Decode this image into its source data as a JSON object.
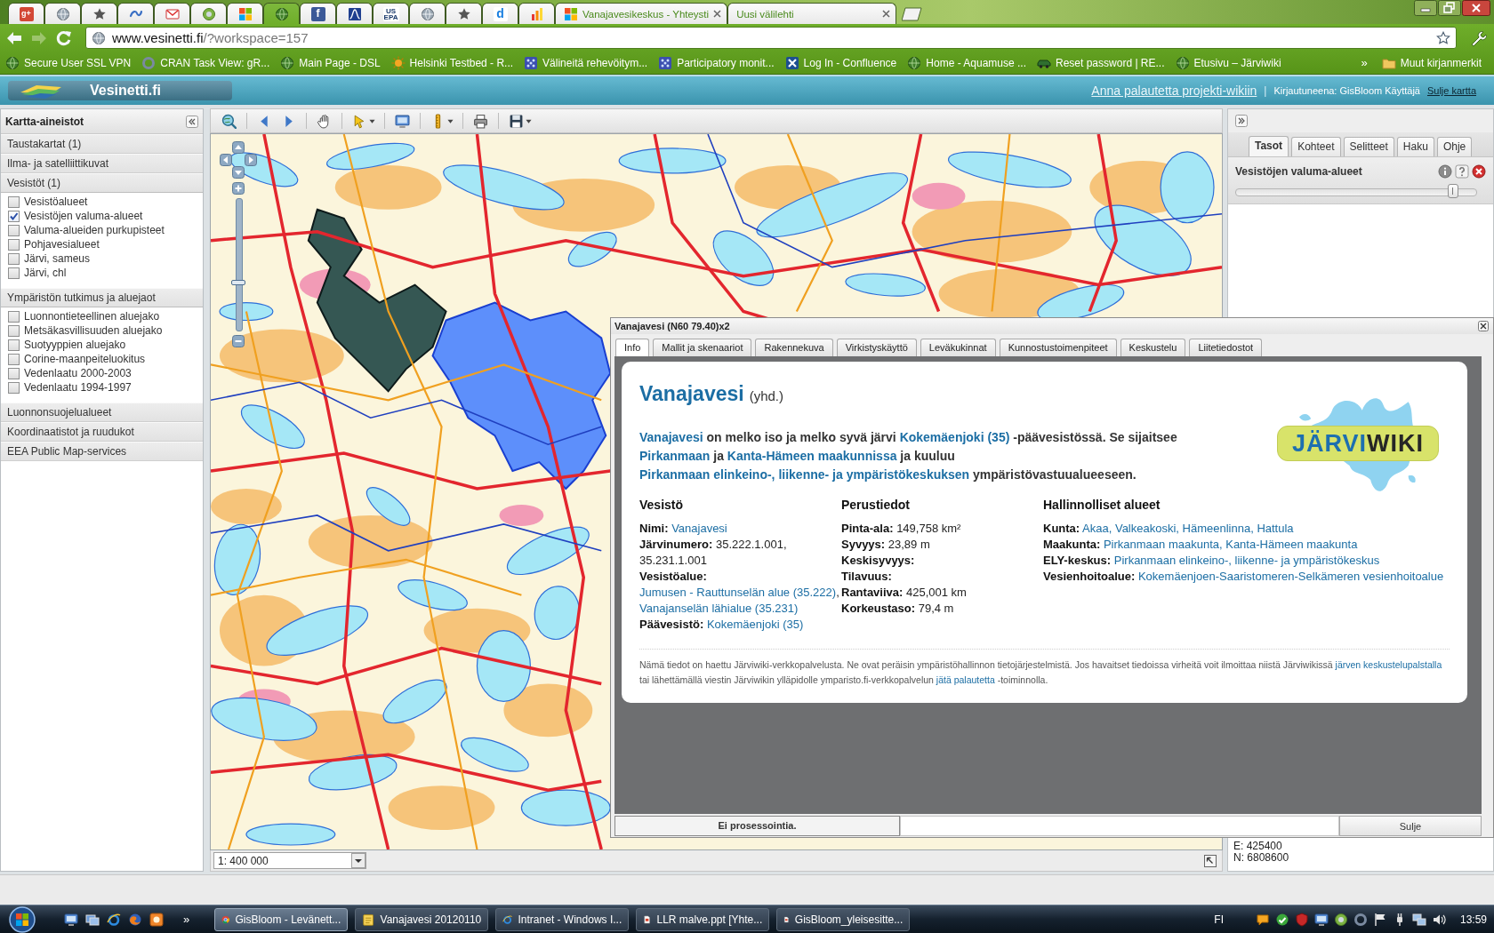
{
  "browser": {
    "pinned_tabs": [
      {
        "label": "g+",
        "selected": false
      },
      {
        "selected": false
      },
      {
        "selected": false
      },
      {
        "selected": false
      },
      {
        "selected": false
      },
      {
        "selected": false
      },
      {
        "selected": false
      },
      {
        "selected": true
      },
      {
        "label": "f",
        "selected": false
      },
      {
        "selected": false
      },
      {
        "label": "US EPA",
        "selected": false
      },
      {
        "selected": false
      },
      {
        "selected": false
      },
      {
        "label": "d",
        "selected": false
      },
      {
        "selected": false
      }
    ],
    "tabs": [
      {
        "title": "Vanajavesikeskus - Yhteysti",
        "selected": false
      },
      {
        "title": "Uusi välilehti",
        "selected": false
      }
    ],
    "address": {
      "host": "www.vesinetti.fi",
      "path": "/?workspace=157"
    },
    "bookmarks": [
      "Secure User SSL VPN",
      "CRAN Task View: gR...",
      "Main Page - DSL",
      "Helsinki Testbed - R...",
      "Välineitä rehevöitym...",
      "Participatory monit...",
      "Log In - Confluence",
      "Home - Aquamuse ...",
      "Reset password | RE...",
      "Etusivu – Järviwiki"
    ],
    "bookmarks_more": "»",
    "other_bookmarks": "Muut kirjanmerkit"
  },
  "header": {
    "logo_text": "Vesinetti.fi",
    "feedback_link": "Anna palautetta projekti-wikiin",
    "separator": "|",
    "login_status": "Kirjautuneena: GisBloom Käyttäjä",
    "close_map_link": "Sulje kartta"
  },
  "sidebar": {
    "title": "Kartta-aineistot",
    "groups": [
      {
        "label": "Taustakartat (1)",
        "expanded": false
      },
      {
        "label": "Ilma- ja satelliittikuvat",
        "expanded": false
      },
      {
        "label": "Vesistöt (1)",
        "expanded": true,
        "items": [
          {
            "label": "Vesistöalueet",
            "checked": false
          },
          {
            "label": "Vesistöjen valuma-alueet",
            "checked": true
          },
          {
            "label": "Valuma-alueiden purkupisteet",
            "checked": false
          },
          {
            "label": "Pohjavesialueet",
            "checked": false
          },
          {
            "label": "Järvi, sameus",
            "checked": false
          },
          {
            "label": "Järvi, chl",
            "checked": false
          }
        ]
      },
      {
        "label": "Ympäristön tutkimus ja aluejaot",
        "expanded": true,
        "items": [
          {
            "label": "Luonnontieteellinen aluejako",
            "checked": false
          },
          {
            "label": "Metsäkasvillisuuden aluejako",
            "checked": false
          },
          {
            "label": "Suotyyppien aluejako",
            "checked": false
          },
          {
            "label": "Corine-maanpeiteluokitus",
            "checked": false
          },
          {
            "label": "Vedenlaatu 2000-2003",
            "checked": false
          },
          {
            "label": "Vedenlaatu 1994-1997",
            "checked": false
          }
        ]
      },
      {
        "label": "Luonnonsuojelualueet",
        "expanded": false
      },
      {
        "label": "Koordinaatistot ja ruudukot",
        "expanded": false
      },
      {
        "label": "EEA Public Map-services",
        "expanded": false
      }
    ]
  },
  "map": {
    "zoom_slider": {
      "level": 0.35
    },
    "scale": "1: 400 000"
  },
  "right_panel": {
    "tabs": [
      {
        "label": "Tasot",
        "selected": true
      },
      {
        "label": "Kohteet",
        "selected": false
      },
      {
        "label": "Selitteet",
        "selected": false
      },
      {
        "label": "Haku",
        "selected": false
      },
      {
        "label": "Ohje",
        "selected": false
      }
    ],
    "layers": [
      {
        "name": "Vesistöjen valuma-alueet",
        "level": 0.9
      }
    ],
    "coordinates": [
      "E: 425400",
      "N: 6808600"
    ]
  },
  "popup": {
    "title": "Vanajavesi (N60 79.40)x2",
    "tabs": [
      {
        "label": "Info",
        "selected": true
      },
      {
        "label": "Mallit ja skenaariot",
        "selected": false
      },
      {
        "label": "Rakennekuva",
        "selected": false
      },
      {
        "label": "Virkistyskäyttö",
        "selected": false
      },
      {
        "label": "Leväkukinnat",
        "selected": false
      },
      {
        "label": "Kunnostustoimenpiteet",
        "selected": false
      },
      {
        "label": "Keskustelu",
        "selected": false
      },
      {
        "label": "Liitetiedostot",
        "selected": false
      }
    ],
    "article": {
      "name": "Vanajavesi",
      "suffix": "(yhd.)",
      "description": [
        {
          "text": "Vanajavesi",
          "link": true
        },
        {
          "text": " on melko iso ja melko syvä järvi ",
          "link": false
        },
        {
          "text": "Kokemäenjoki (35)",
          "link": true
        },
        {
          "text": " -päävesistössä. Se sijaitsee ",
          "link": false
        },
        {
          "text": "Pirkanmaan",
          "link": true
        },
        {
          "text": " ja ",
          "link": false
        },
        {
          "text": "Kanta-Hämeen maakunnissa",
          "link": true
        },
        {
          "text": " ja kuuluu ",
          "link": false
        },
        {
          "text": "Pirkanmaan elinkeino-, liikenne- ja ympäristökeskuksen",
          "link": true
        },
        {
          "text": " ympäristövastuualueeseen.",
          "link": false
        }
      ],
      "logo": {
        "wordmark": [
          "JÄRVI",
          "WIKI"
        ]
      },
      "sections": [
        {
          "heading": "Vesistö",
          "fields": [
            {
              "label": "Nimi:",
              "value": [
                {
                  "text": "Vanajavesi",
                  "link": true
                }
              ]
            },
            {
              "label": "Järvinumero:",
              "value": [
                {
                  "text": "35.222.1.001, 35.231.1.001",
                  "link": false
                }
              ]
            },
            {
              "label": "Vesistöalue:",
              "value": [
                {
                  "text": "Jumusen - Rauttunselän alue (35.222)",
                  "link": true
                },
                {
                  "text": ", ",
                  "link": false
                },
                {
                  "text": "Vanajanselän lähialue (35.231)",
                  "link": true
                }
              ]
            },
            {
              "label": "Päävesistö:",
              "value": [
                {
                  "text": "Kokemäenjoki (35)",
                  "link": true
                }
              ]
            }
          ]
        },
        {
          "heading": "Perustiedot",
          "fields": [
            {
              "label": "Pinta-ala:",
              "value": [
                {
                  "text": "149,758 km²",
                  "link": false
                }
              ]
            },
            {
              "label": "Syvyys:",
              "value": [
                {
                  "text": "23,89 m",
                  "link": false
                }
              ]
            },
            {
              "label": "Keskisyvyys:"
            },
            {
              "label": "Tilavuus:"
            },
            {
              "label": "Rantaviiva:",
              "value": [
                {
                  "text": "425,001 km",
                  "link": false
                }
              ]
            },
            {
              "label": "Korkeustaso:",
              "value": [
                {
                  "text": "79,4 m",
                  "link": false
                }
              ]
            }
          ]
        },
        {
          "heading": "Hallinnolliset alueet",
          "fields": [
            {
              "label": "Kunta:",
              "value": [
                {
                  "text": "Akaa, Valkeakoski, Hämeenlinna, Hattula",
                  "link": true
                }
              ]
            },
            {
              "label": "Maakunta:",
              "value": [
                {
                  "text": "Pirkanmaan maakunta, Kanta-Hämeen maakunta",
                  "link": true
                }
              ]
            },
            {
              "label": "ELY-keskus:",
              "value": [
                {
                  "text": "Pirkanmaan elinkeino-, liikenne- ja ympäristökeskus",
                  "link": true
                }
              ]
            },
            {
              "label": "Vesienhoitoalue:",
              "value": [
                {
                  "text": "Kokemäenjoen-Saaristomeren-Selkämeren vesienhoitoalue",
                  "link": true
                }
              ]
            }
          ]
        }
      ],
      "note": [
        {
          "text": "Nämä tiedot on haettu Järviwiki-verkkopalvelusta. Ne ovat peräisin ympäristöhallinnon tietojärjestelmistä. Jos havaitset tiedoissa virheitä voit ilmoittaa niistä Järviwikissä ",
          "link": false
        },
        {
          "text": "järven keskustelupalstalla",
          "link": true
        },
        {
          "text": " tai lähettämällä viestin Järviwikin ylläpidolle ymparisto.fi-verkkopalvelun ",
          "link": false
        },
        {
          "text": "jätä palautetta",
          "link": true
        },
        {
          "text": " -toiminnolla.",
          "link": false
        }
      ]
    },
    "status": "Ei prosessointia.",
    "close_button": "Sulje"
  },
  "taskbar": {
    "quick_launch_more": "»",
    "tasks": [
      {
        "label": "GisBloom - Levänett...",
        "selected": true
      },
      {
        "label": "Vanajavesi 20120110",
        "selected": false
      },
      {
        "label": "Intranet - Windows I...",
        "selected": false
      },
      {
        "label": "LLR malve.ppt [Yhte...",
        "selected": false
      },
      {
        "label": "GisBloom_yleisesitte...",
        "selected": false
      }
    ],
    "language": "FI",
    "clock": "13:59"
  }
}
